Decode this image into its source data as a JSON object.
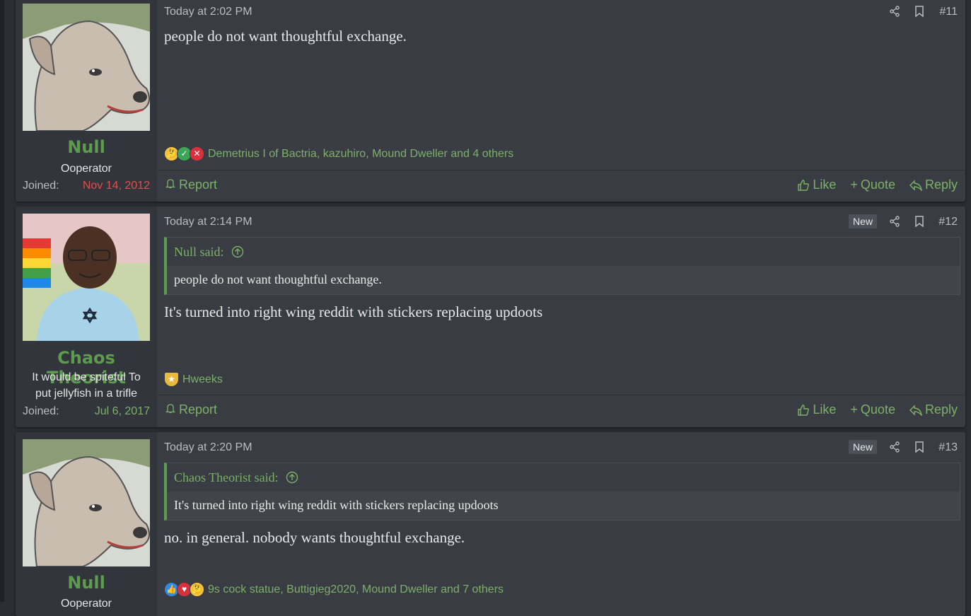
{
  "posts": [
    {
      "user": {
        "name": "Null",
        "title": "Ooperator",
        "joined_label": "Joined:",
        "joined": "Nov 14, 2012",
        "joined_color": "#e05050"
      },
      "date": "Today at 2:02 PM",
      "new_badge": "",
      "number": "#11",
      "quote": null,
      "message": "people do not want thoughtful exchange.",
      "reaction_names": "Demetrius I of Bactria, kazuhiro, Mound Dweller and 4 others",
      "reaction_icons": [
        "thinking-emoji",
        "check-emoji",
        "x-emoji"
      ]
    },
    {
      "user": {
        "name": "Chaos Theorist",
        "title_lines": [
          "It would be spiteful To",
          "put jellyfish in a trifle"
        ],
        "joined_label": "Joined:",
        "joined": "Jul 6, 2017",
        "joined_color": "#7cb068"
      },
      "date": "Today at 2:14 PM",
      "new_badge": "New",
      "number": "#12",
      "quote": {
        "author": "Null said:",
        "text": "people do not want thoughtful exchange."
      },
      "message": "It's turned into right wing reddit with stickers replacing updoots",
      "reaction_names": "Hweeks",
      "reaction_icons": [
        "medal-emoji"
      ]
    },
    {
      "user": {
        "name": "Null",
        "title": "Ooperator"
      },
      "date": "Today at 2:20 PM",
      "new_badge": "New",
      "number": "#13",
      "quote": {
        "author": "Chaos Theorist said:",
        "text": "It's turned into right wing reddit with stickers replacing updoots"
      },
      "message": "no. in general. nobody wants thoughtful exchange.",
      "reaction_names": "9s cock statue, Buttigieg2020, Mound Dweller and 7 others",
      "reaction_icons": [
        "thumbs-up-emoji",
        "heart-emoji",
        "thinking-emoji"
      ]
    }
  ],
  "footer": {
    "report": "Report",
    "like": "Like",
    "quote": "Quote",
    "reply": "Reply"
  },
  "colors": {
    "accent": "#5d9b4f",
    "link": "#7cb068",
    "background": "#393c43",
    "sidebar": "#32353b"
  }
}
